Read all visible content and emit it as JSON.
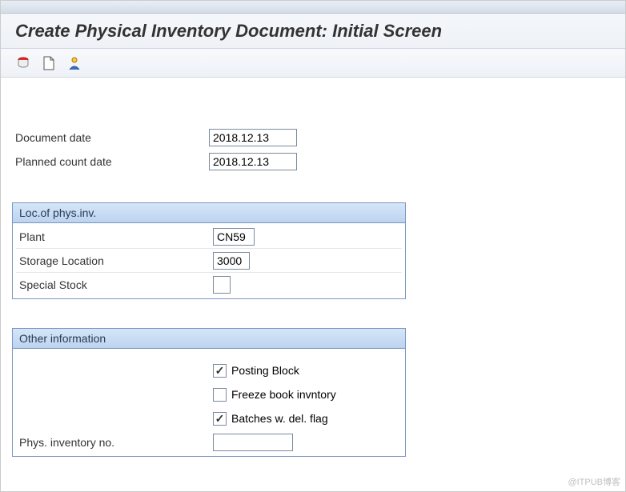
{
  "title": "Create Physical Inventory Document: Initial Screen",
  "icons": {
    "icon1": "database-icon",
    "icon2": "page-icon",
    "icon3": "person-icon"
  },
  "dates": {
    "document_date_label": "Document date",
    "document_date": "2018.12.13",
    "planned_count_date_label": "Planned count date",
    "planned_count_date": "2018.12.13"
  },
  "loc_panel": {
    "header": "Loc.of phys.inv.",
    "plant_label": "Plant",
    "plant": "CN59",
    "storage_location_label": "Storage Location",
    "storage_location": "3000",
    "special_stock_label": "Special Stock",
    "special_stock": ""
  },
  "other_panel": {
    "header": "Other information",
    "posting_block_label": "Posting Block",
    "posting_block_checked": true,
    "freeze_label": "Freeze book invntory",
    "freeze_checked": false,
    "batches_label": "Batches w. del. flag",
    "batches_checked": true,
    "phys_inv_no_label": "Phys. inventory no.",
    "phys_inv_no": ""
  },
  "watermark": "@ITPUB博客"
}
